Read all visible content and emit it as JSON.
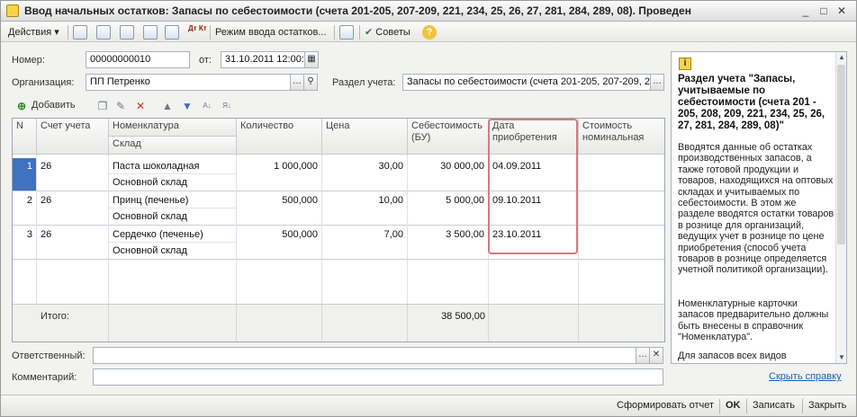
{
  "window": {
    "title": "Ввод начальных остатков: Запасы по себестоимости (счета 201-205, 207-209, 221, 234, 25, 26, 27, 281, 284, 289, 08). Проведен"
  },
  "toolbar": {
    "actions_label": "Действия",
    "mode_label": "Режим ввода остатков...",
    "tips_label": "Советы",
    "dtkt_label": "Дт Кт"
  },
  "form": {
    "number_label": "Номер:",
    "number_value": "00000000010",
    "date_label": "от:",
    "date_value": "31.10.2011 12:00:",
    "org_label": "Организация:",
    "org_value": "ПП Петренко",
    "section_label": "Раздел учета:",
    "section_value": "Запасы по себестоимости (счета 201-205, 207-209, 2",
    "responsible_label": "Ответственный:",
    "responsible_value": "",
    "comment_label": "Комментарий:",
    "comment_value": ""
  },
  "table_toolbar": {
    "add_label": "Добавить"
  },
  "table": {
    "headers": {
      "n": "N",
      "account": "Счет учета",
      "nomenclature": "Номенклатура",
      "warehouse": "Склад",
      "quantity": "Количество",
      "price": "Цена",
      "cost": "Себестоимость (БУ)",
      "acq_date": "Дата приобретения",
      "nominal": "Стоимость номинальная"
    },
    "rows": [
      {
        "n": "1",
        "account": "26",
        "item": "Паста шоколадная",
        "warehouse": "Основной склад",
        "quantity": "1 000,000",
        "price": "30,00",
        "cost": "30 000,00",
        "date": "04.09.2011",
        "nominal": ""
      },
      {
        "n": "2",
        "account": "26",
        "item": "Принц (печенье)",
        "warehouse": "Основной склад",
        "quantity": "500,000",
        "price": "10,00",
        "cost": "5 000,00",
        "date": "09.10.2011",
        "nominal": ""
      },
      {
        "n": "3",
        "account": "26",
        "item": "Сердечко (печенье)",
        "warehouse": "Основной склад",
        "quantity": "500,000",
        "price": "7,00",
        "cost": "3 500,00",
        "date": "23.10.2011",
        "nominal": ""
      }
    ],
    "total_label": "Итого:",
    "total_cost": "38 500,00"
  },
  "help": {
    "title": "Раздел учета \"Запасы, учитываемые по себестоимости (счета 201 - 205, 208, 209, 221, 234, 25, 26, 27, 281, 284, 289, 08)\"",
    "p1": "Вводятся данные об остатках производственных запасов, а также готовой продукции и товаров, находящихся на оптовых складах и учитываемых по себестоимости. В этом же разделе вводятся остатки товаров в рознице для организаций, ведущих учет в рознице по цене приобретения (способ учета товаров в рознице определяется учетной политикой организации).",
    "p2": "Номенклатурные карточки запасов предварительно должны быть внесены в справочник \"Номенклатура\".",
    "p3": "Для запасов всех видов",
    "hide_link": "Скрыть справку"
  },
  "bottom": {
    "report_label": "Сформировать отчет",
    "ok_label": "OK",
    "save_label": "Записать",
    "close_label": "Закрыть"
  },
  "colors": {
    "selection": "#3f72c0",
    "highlight_frame": "#d77a7a",
    "link": "#1f5fc0"
  }
}
